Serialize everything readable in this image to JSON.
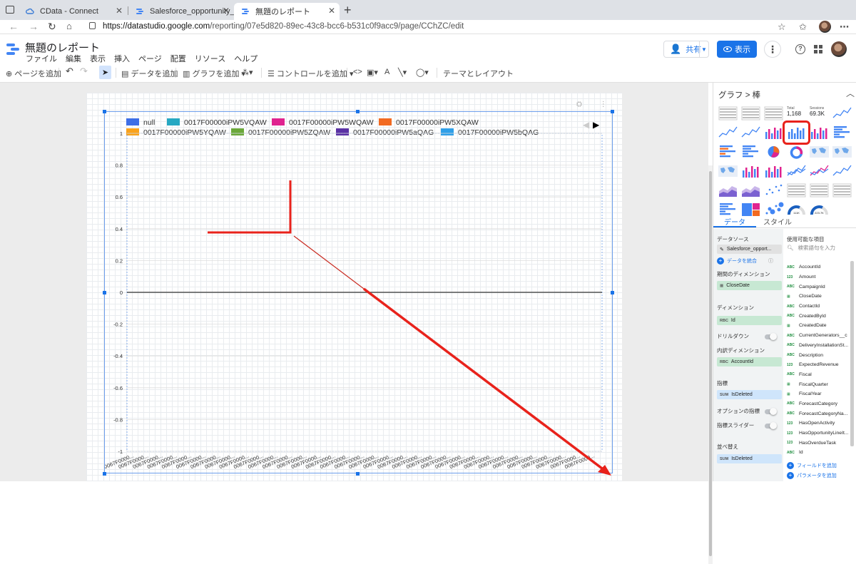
{
  "browser": {
    "tabs": [
      {
        "title": "CData - Connect"
      },
      {
        "title": "Salesforce_opportunity_Kuwa"
      },
      {
        "title": "無題のレポート"
      }
    ],
    "url_host": "https://datastudio.google.com",
    "url_path": "/reporting/07e5d820-89ec-43c8-bcc6-b531c0f9acc9/page/CChZC/edit"
  },
  "app": {
    "title": "無題のレポート",
    "menus": [
      "ファイル",
      "編集",
      "表示",
      "挿入",
      "ページ",
      "配置",
      "リソース",
      "ヘルプ"
    ],
    "share_label": "共有",
    "view_label": "表示"
  },
  "toolbar": {
    "add_page": "ページを追加",
    "add_data": "データを追加",
    "add_chart": "グラフを追加",
    "add_control": "コントロールを追加",
    "theme": "テーマとレイアウト"
  },
  "chart_data": {
    "type": "bar",
    "legend": [
      {
        "name": "null",
        "color": "#3d6ee6"
      },
      {
        "name": "0017F00000iPW5VQAW",
        "color": "#26a8c2"
      },
      {
        "name": "0017F00000iPW5WQAW",
        "color": "#e0238f"
      },
      {
        "name": "0017F00000iPW5XQAW",
        "color": "#f26a21"
      },
      {
        "name": "0017F00000iPW5YQAW",
        "color": "#f9a21b"
      },
      {
        "name": "0017F00000iPW5ZQAW",
        "color": "#6ba83a"
      },
      {
        "name": "0017F00000iPW5aQAG",
        "color": "#5a31a4"
      },
      {
        "name": "0017F00000iPW5bQAG",
        "color": "#2f9fe8"
      }
    ],
    "y_ticks": [
      "1",
      "0.8",
      "0.6",
      "0.4",
      "0.2",
      "0",
      "-0.2",
      "-0.4",
      "-0.6",
      "-0.8",
      "-1"
    ],
    "x_tick_label": "0067F0000...",
    "x_tick_count": 33,
    "ylim": [
      -1,
      1
    ]
  },
  "panel": {
    "title": "グラフ",
    "subtitle": "棒",
    "tab_data": "データ",
    "tab_style": "スタイル",
    "data_source_label": "データソース",
    "data_source_value": "Salesforce_opport...",
    "blend_label": "データを統合",
    "period_dim_label": "期間のディメンション",
    "period_dim_value": "CloseDate",
    "dimension_label": "ディメンション",
    "dimension_value": "Id",
    "drilldown_label": "ドリルダウン",
    "breakdown_label": "内訳ディメンション",
    "breakdown_value": "AccountId",
    "metric_label": "指標",
    "metric_value": "IsDeleted",
    "metric_type": "SUM",
    "optional_metric_label": "オプションの指標",
    "metric_slider_label": "指標スライダー",
    "sort_label": "並べ替え",
    "sort_value": "IsDeleted",
    "available_label": "使用可能な項目",
    "search_placeholder": "検索語句を入力",
    "fields": [
      {
        "type": "ABC",
        "name": "AccountId"
      },
      {
        "type": "123",
        "name": "Amount"
      },
      {
        "type": "ABC",
        "name": "CampaignId"
      },
      {
        "type": "cal",
        "name": "CloseDate"
      },
      {
        "type": "ABC",
        "name": "ContactId"
      },
      {
        "type": "ABC",
        "name": "CreatedById"
      },
      {
        "type": "cal",
        "name": "CreatedDate"
      },
      {
        "type": "ABC",
        "name": "CurrentGenerators__c"
      },
      {
        "type": "ABC",
        "name": "DeliveryInstallationSt..."
      },
      {
        "type": "ABC",
        "name": "Description"
      },
      {
        "type": "123",
        "name": "ExpectedRevenue"
      },
      {
        "type": "ABC",
        "name": "Fiscal"
      },
      {
        "type": "cal",
        "name": "FiscalQuarter"
      },
      {
        "type": "cal",
        "name": "FiscalYear"
      },
      {
        "type": "ABC",
        "name": "ForecastCategory"
      },
      {
        "type": "ABC",
        "name": "ForecastCategoryNa..."
      },
      {
        "type": "123",
        "name": "HasOpenActivity"
      },
      {
        "type": "123",
        "name": "HasOpportunityLineIt..."
      },
      {
        "type": "123",
        "name": "HasOverdueTask"
      },
      {
        "type": "ABC",
        "name": "Id"
      }
    ],
    "add_field": "フィールドを追加",
    "add_param": "パラメータを追加",
    "scorecard_total_label": "Total",
    "scorecard_total_value": "1,168",
    "scorecard_sessions_label": "Sessions",
    "scorecard_sessions_value": "69.3K",
    "gauge_value_1": "111K",
    "gauge_value_2": "223.7K"
  }
}
